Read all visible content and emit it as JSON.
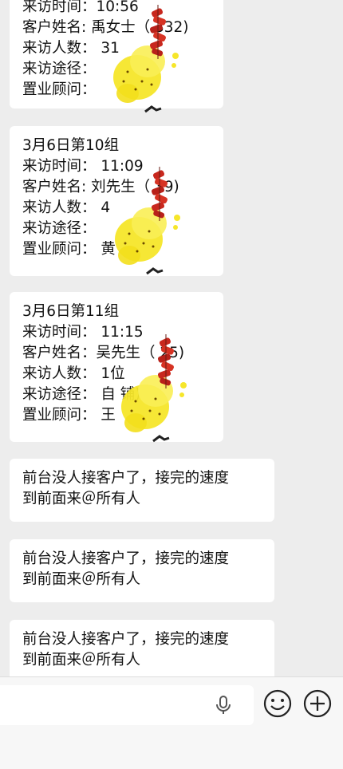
{
  "messages": [
    {
      "lines": [
        "来访时间：10:56",
        "客户姓名: 禹女士（    332)",
        "来访人数：  31",
        "来访途径：  ",
        "置业顾问：  "
      ]
    },
    {
      "lines": [
        "3月6日第10组",
        "来访时间：  11:09",
        "客户姓名: 刘先生（     39)",
        "来访人数：  4",
        "来访途径：  ",
        "置业顾问：  黄"
      ]
    },
    {
      "lines": [
        "3月6日第11组",
        "来访时间：  11:15",
        "客户姓名：吴先生（      25)",
        "来访人数：  1位",
        "来访途径：  自               铺)",
        "置业顾问：  王"
      ]
    },
    {
      "lines": [
        "前台没人接客户了，接完的速度",
        "到前面来＠所有人"
      ]
    },
    {
      "lines": [
        "前台没人接客户了，接完的速度",
        "到前面来＠所有人"
      ]
    },
    {
      "lines": [
        "前台没人接客户了，接完的速度",
        "到前面来＠所有人"
      ]
    }
  ],
  "input_bar": {
    "mic_icon": "microphone-icon",
    "emoji_icon": "emoji-icon",
    "plus_icon": "plus-icon"
  },
  "colors": {
    "background": "#ededed",
    "bubble": "#ffffff",
    "firecracker_red": "#c8281e",
    "spark_yellow": "#f6e62a"
  }
}
